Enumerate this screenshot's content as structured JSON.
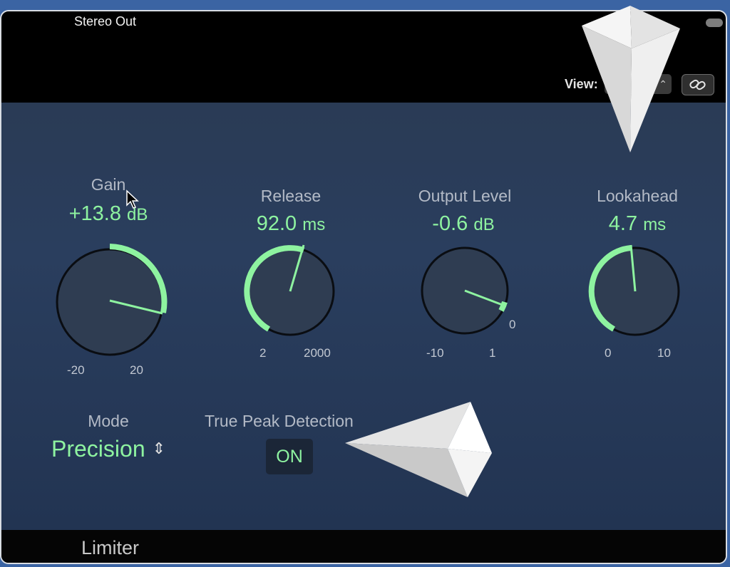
{
  "window": {
    "title": "Stereo Out"
  },
  "header": {
    "view_label": "View:",
    "view_value": ""
  },
  "knobs": [
    {
      "id": "gain",
      "label": "Gain",
      "value": "+13.8",
      "unit": "dB",
      "min": "-20",
      "max": "20"
    },
    {
      "id": "release",
      "label": "Release",
      "value": "92.0",
      "unit": "ms",
      "min": "2",
      "max": "2000"
    },
    {
      "id": "output-level",
      "label": "Output Level",
      "value": "-0.6",
      "unit": "dB",
      "min": "-10",
      "max": "1",
      "extra_tick": "0"
    },
    {
      "id": "lookahead",
      "label": "Lookahead",
      "value": "4.7",
      "unit": "ms",
      "min": "0",
      "max": "10"
    }
  ],
  "mode": {
    "label": "Mode",
    "value": "Precision"
  },
  "true_peak": {
    "label": "True Peak Detection",
    "state": "ON"
  },
  "footer": {
    "plugin_name": "Limiter"
  },
  "colors": {
    "accent": "#8ef3a0",
    "panel": "#2a3e5e",
    "label": "#b3bac6"
  },
  "icons": [
    "chevron-updown-icon",
    "link-icon",
    "cursor-icon",
    "white-triangle-pointer-icon"
  ]
}
